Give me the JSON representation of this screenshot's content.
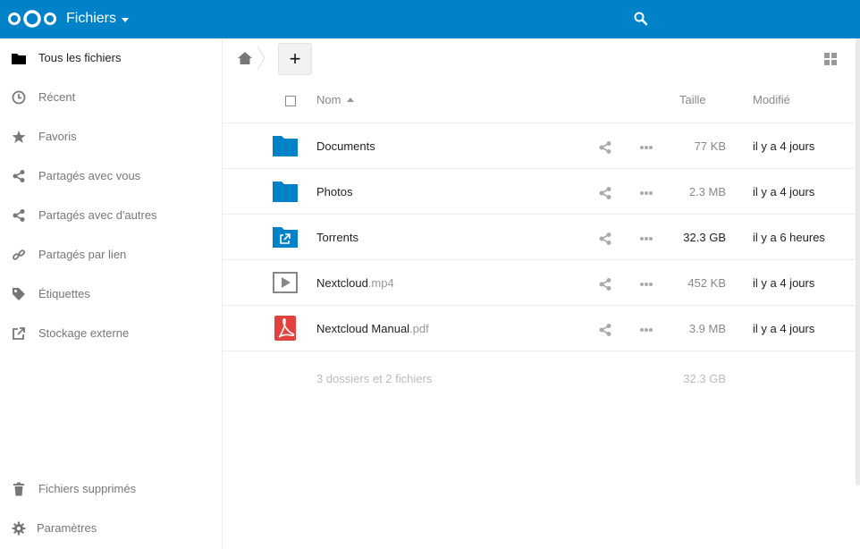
{
  "header": {
    "app_title": "Fichiers",
    "brand_color": "#0082c9"
  },
  "sidebar": {
    "items": [
      {
        "label": "Tous les fichiers",
        "icon": "folder-icon",
        "active": true
      },
      {
        "label": "Récent",
        "icon": "clock-icon"
      },
      {
        "label": "Favoris",
        "icon": "star-icon"
      },
      {
        "label": "Partagés avec vous",
        "icon": "share-icon"
      },
      {
        "label": "Partagés avec d'autres",
        "icon": "share-icon"
      },
      {
        "label": "Partagés par lien",
        "icon": "link-icon"
      },
      {
        "label": "Étiquettes",
        "icon": "tag-icon"
      },
      {
        "label": "Stockage externe",
        "icon": "external-icon"
      }
    ],
    "bottom_items": [
      {
        "label": "Fichiers supprimés",
        "icon": "trash-icon"
      },
      {
        "label": "Paramètres",
        "icon": "gear-icon"
      }
    ]
  },
  "toolbar": {
    "new_label": "+"
  },
  "table": {
    "headers": {
      "name": "Nom",
      "size": "Taille",
      "modified": "Modifié"
    },
    "rows": [
      {
        "name": "Documents",
        "ext": "",
        "icon": "folder-icon",
        "size": "77 KB",
        "modified": "il y a 4 jours"
      },
      {
        "name": "Photos",
        "ext": "",
        "icon": "folder-icon",
        "size": "2.3 MB",
        "modified": "il y a 4 jours"
      },
      {
        "name": "Torrents",
        "ext": "",
        "icon": "external-folder-icon",
        "size": "32.3 GB",
        "modified": "il y a 6 heures"
      },
      {
        "name": "Nextcloud",
        "ext": ".mp4",
        "icon": "video-icon",
        "size": "452 KB",
        "modified": "il y a 4 jours"
      },
      {
        "name": "Nextcloud Manual",
        "ext": ".pdf",
        "icon": "pdf-icon",
        "size": "3.9 MB",
        "modified": "il y a 4 jours"
      }
    ],
    "summary": "3 dossiers et 2 fichiers",
    "summary_size": "32.3 GB"
  }
}
